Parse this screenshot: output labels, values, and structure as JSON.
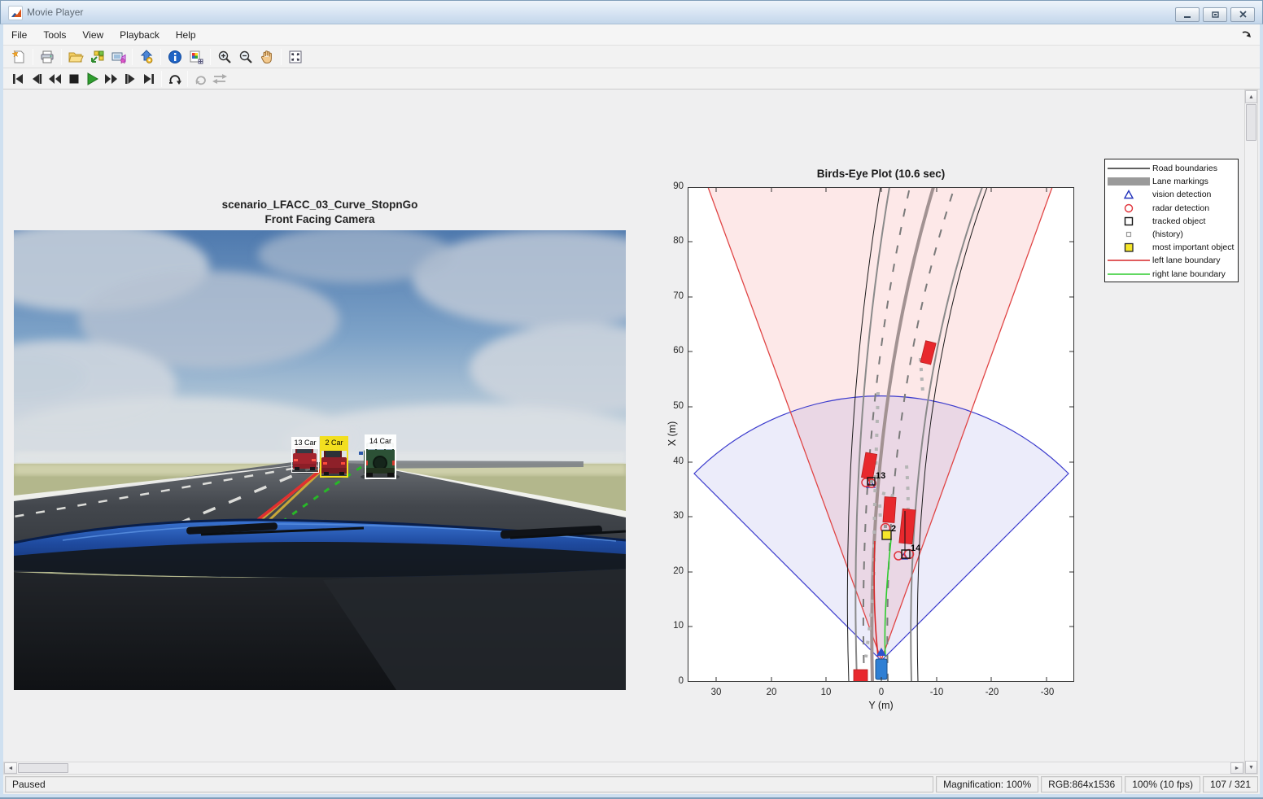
{
  "window": {
    "title": "Movie Player"
  },
  "menu": {
    "items": [
      "File",
      "Tools",
      "View",
      "Playback",
      "Help"
    ]
  },
  "toolbar": {
    "icons": [
      "new-file",
      "print",
      "open",
      "import-from-workspace",
      "export-to-video-viewer",
      "export-movie",
      "info",
      "pixel-region",
      "zoom-in",
      "zoom-out",
      "pan",
      "maximize-axes"
    ]
  },
  "playback": {
    "icons": [
      "go-to-first",
      "step-back",
      "rewind",
      "stop",
      "play",
      "fast-forward",
      "step-forward",
      "go-to-last",
      "repeat",
      "autoreverse",
      "playback-direction"
    ]
  },
  "camera": {
    "title_line1": "scenario_LFACC_03_Curve_StopnGo",
    "title_line2": "Front Facing Camera",
    "annotations": [
      {
        "id": "13",
        "class": "Car",
        "label": "13 Car",
        "box_color": "#ffffff"
      },
      {
        "id": "2",
        "class": "Car",
        "label": "2 Car",
        "box_color": "#f2df1f"
      },
      {
        "id": "14",
        "class": "Car",
        "label": "14 Car",
        "box_color": "#ffffff"
      }
    ]
  },
  "birds_eye": {
    "title": "Birds-Eye Plot (10.6 sec)",
    "xlabel": "Y (m)",
    "ylabel": "X (m)",
    "x_ticks": [
      "30",
      "20",
      "10",
      "0",
      "-10",
      "-20",
      "-30"
    ],
    "y_ticks": [
      "90",
      "80",
      "70",
      "60",
      "50",
      "40",
      "30",
      "20",
      "10",
      "0"
    ],
    "tracks": [
      {
        "id": "13"
      },
      {
        "id": "2"
      },
      {
        "id": "14"
      }
    ],
    "legend": [
      {
        "label": "Road boundaries",
        "marker": "black-line"
      },
      {
        "label": "Lane markings",
        "marker": "gray-bar"
      },
      {
        "label": "vision detection",
        "marker": "blue-triangle"
      },
      {
        "label": "radar detection",
        "marker": "red-circle"
      },
      {
        "label": "tracked object",
        "marker": "black-square"
      },
      {
        "label": "(history)",
        "marker": "small-gray-square"
      },
      {
        "label": "most important object",
        "marker": "yellow-square"
      },
      {
        "label": "left lane boundary",
        "marker": "red-line"
      },
      {
        "label": "right lane boundary",
        "marker": "green-line"
      }
    ],
    "colors": {
      "radar_coverage": "#e04545",
      "vision_coverage": "#3b3bcd",
      "car": "#e8282d",
      "ego": "#2f7fd4",
      "most_important": "#f6e62a",
      "left_lane": "#d62728",
      "right_lane": "#2ecc2e",
      "lane_marking": "#9a9a9a",
      "road_boundary": "#000000"
    }
  },
  "status": {
    "state": "Paused",
    "magnification": "Magnification: 100%",
    "image_size": "RGB:864x1536",
    "playback_rate": "100% (10 fps)",
    "frame_counter": "107 / 321"
  }
}
